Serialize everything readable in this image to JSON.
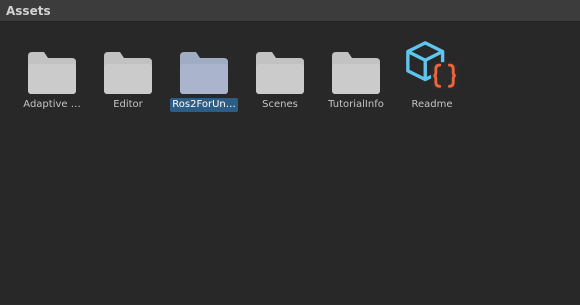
{
  "panel": {
    "title": "Assets"
  },
  "assets": [
    {
      "label": "Adaptive …",
      "kind": "folder",
      "icon": "folder-icon",
      "selected": false
    },
    {
      "label": "Editor",
      "kind": "folder",
      "icon": "folder-icon",
      "selected": false
    },
    {
      "label": "Ros2ForUn…",
      "kind": "folder",
      "icon": "folder-icon",
      "selected": true
    },
    {
      "label": "Scenes",
      "kind": "folder",
      "icon": "folder-icon",
      "selected": false
    },
    {
      "label": "TutorialInfo",
      "kind": "folder",
      "icon": "folder-icon",
      "selected": false
    },
    {
      "label": "Readme",
      "kind": "script-asset",
      "icon": "readme-cube-icon",
      "selected": false
    }
  ],
  "colors": {
    "folder": "#c2c2c2",
    "folder_selected": "#a9b5cf",
    "selection": "#2c5d87",
    "readme_cube": "#5ec6ee",
    "readme_braces": "#f0643c"
  }
}
